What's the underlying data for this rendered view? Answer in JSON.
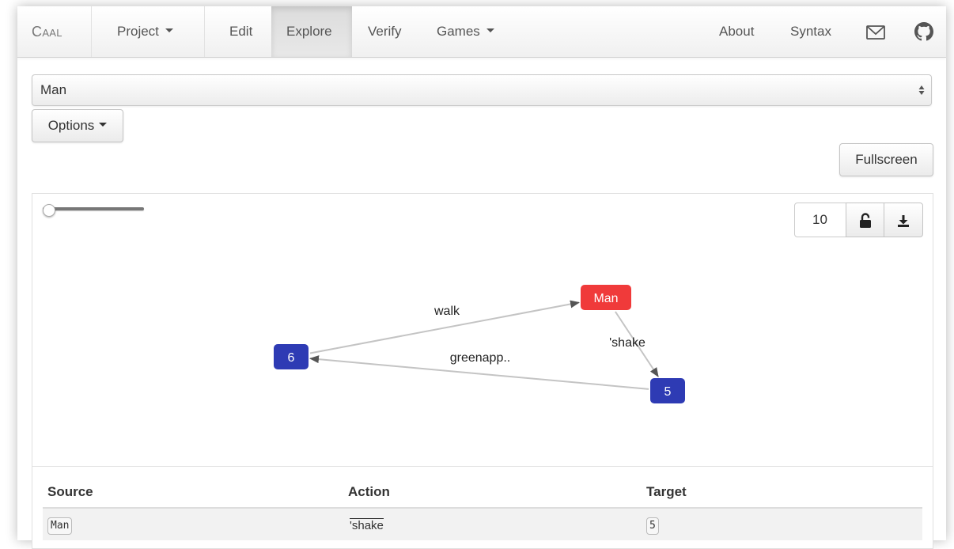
{
  "navbar": {
    "brand": {
      "first": "C",
      "rest": "AAL"
    },
    "items": [
      {
        "label": "Project",
        "dropdown": true
      },
      {
        "label": "Edit"
      },
      {
        "label": "Explore",
        "active": true
      },
      {
        "label": "Verify"
      },
      {
        "label": "Games",
        "dropdown": true
      }
    ],
    "right": [
      {
        "label": "About"
      },
      {
        "label": "Syntax"
      }
    ],
    "icons": [
      "envelope-icon",
      "github-icon"
    ]
  },
  "process_select": {
    "value": "Man"
  },
  "options_button": {
    "label": "Options"
  },
  "fullscreen_button": {
    "label": "Fullscreen"
  },
  "graph": {
    "depth_input": "10",
    "depth_slider_fraction": 0.0,
    "toolbar_icons": [
      "lock-open-icon",
      "download-icon"
    ],
    "nodes": [
      {
        "id": "Man",
        "label": "Man",
        "color": "#f03a3a"
      },
      {
        "id": "6",
        "label": "6",
        "color": "#2e3bb4"
      },
      {
        "id": "5",
        "label": "5",
        "color": "#2e3bb4"
      }
    ],
    "edges": [
      {
        "from": "6",
        "to": "Man",
        "label": "walk"
      },
      {
        "from": "Man",
        "to": "5",
        "label": "'shake"
      },
      {
        "from": "5",
        "to": "6",
        "label": "greenapp.."
      }
    ]
  },
  "transitions_table": {
    "headers": {
      "source": "Source",
      "action": "Action",
      "target": "Target"
    },
    "rows": [
      {
        "source": "Man",
        "action_prefix": "'",
        "action": "shake",
        "target": "5"
      }
    ]
  },
  "colors": {
    "node_current": "#f03a3a",
    "node_other": "#2e3bb4",
    "edge": "#c4c4c4",
    "arrow": "#555555"
  }
}
